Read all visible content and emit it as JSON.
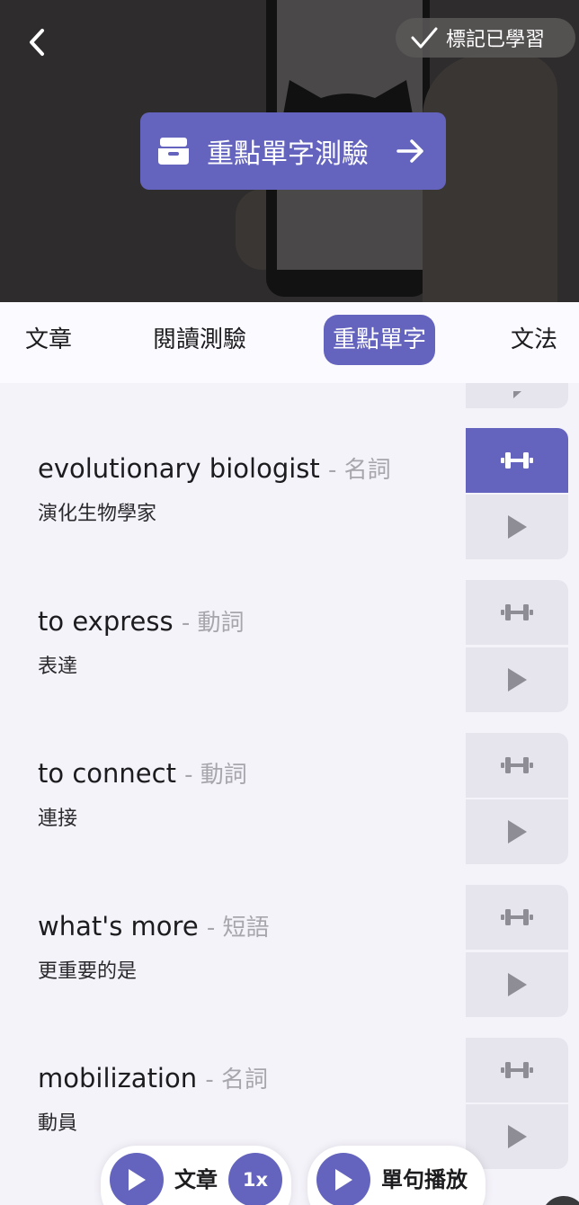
{
  "header": {
    "mark_learned_label": "標記已學習",
    "quiz_button_label": "重點單字測驗"
  },
  "tabs": [
    {
      "label": "文章",
      "active": false
    },
    {
      "label": "閱讀測驗",
      "active": false
    },
    {
      "label": "重點單字",
      "active": true
    },
    {
      "label": "文法",
      "active": false
    }
  ],
  "words": [
    {
      "term": "evolutionary biologist",
      "pos": "- 名詞",
      "translation": "演化生物學家",
      "practice_selected": true
    },
    {
      "term": "to express",
      "pos": "- 動詞",
      "translation": "表達",
      "practice_selected": false
    },
    {
      "term": "to connect",
      "pos": "- 動詞",
      "translation": "連接",
      "practice_selected": false
    },
    {
      "term": "what's more",
      "pos": "- 短語",
      "translation": "更重要的是",
      "practice_selected": false
    },
    {
      "term": "mobilization",
      "pos": "- 名詞",
      "translation": "動員",
      "practice_selected": false
    }
  ],
  "player": {
    "article_label": "文章",
    "speed_label": "1x",
    "sentence_label": "單句播放"
  },
  "colors": {
    "accent": "#6464be",
    "background": "#f5f3fa",
    "muted_text": "#a8a6ad",
    "action_bg": "#e6e4ec"
  },
  "icons": {
    "back": "chevron-left-icon",
    "mark": "check-icon",
    "quiz": "inbox-tray-icon",
    "quiz_arrow": "arrow-right-icon",
    "practice": "dumbbell-icon",
    "play": "play-icon"
  }
}
